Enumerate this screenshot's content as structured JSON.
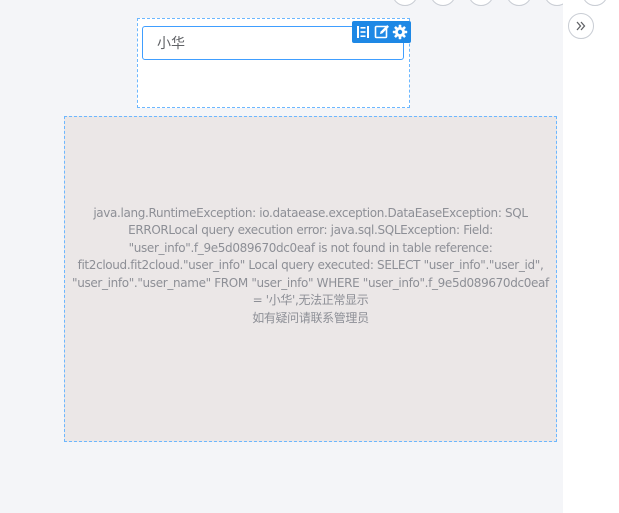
{
  "filter": {
    "input_value": "小华"
  },
  "chart": {
    "error_message": "java.lang.RuntimeException: io.dataease.exception.DataEaseException: SQL ERRORLocal query execution error: java.sql.SQLException: Field: \"user_info\".f_9e5d089670dc0eaf is not found in table reference: fit2cloud.fit2cloud.\"user_info\" Local query executed: SELECT \"user_info\".\"user_id\", \"user_info\".\"user_name\" FROM \"user_info\" WHERE \"user_info\".f_9e5d089670dc0eaf = '小华',无法正常显示",
    "contact_admin": "如有疑问请联系管理员"
  },
  "colors": {
    "accent": "#409eff",
    "toolbar": "#1e88e5",
    "chart_bg": "#ebe7e7",
    "canvas_bg": "#f4f5f8"
  },
  "icons": [
    "field-mapping-icon",
    "edit-icon",
    "settings-icon",
    "double-chevron-right-icon"
  ]
}
